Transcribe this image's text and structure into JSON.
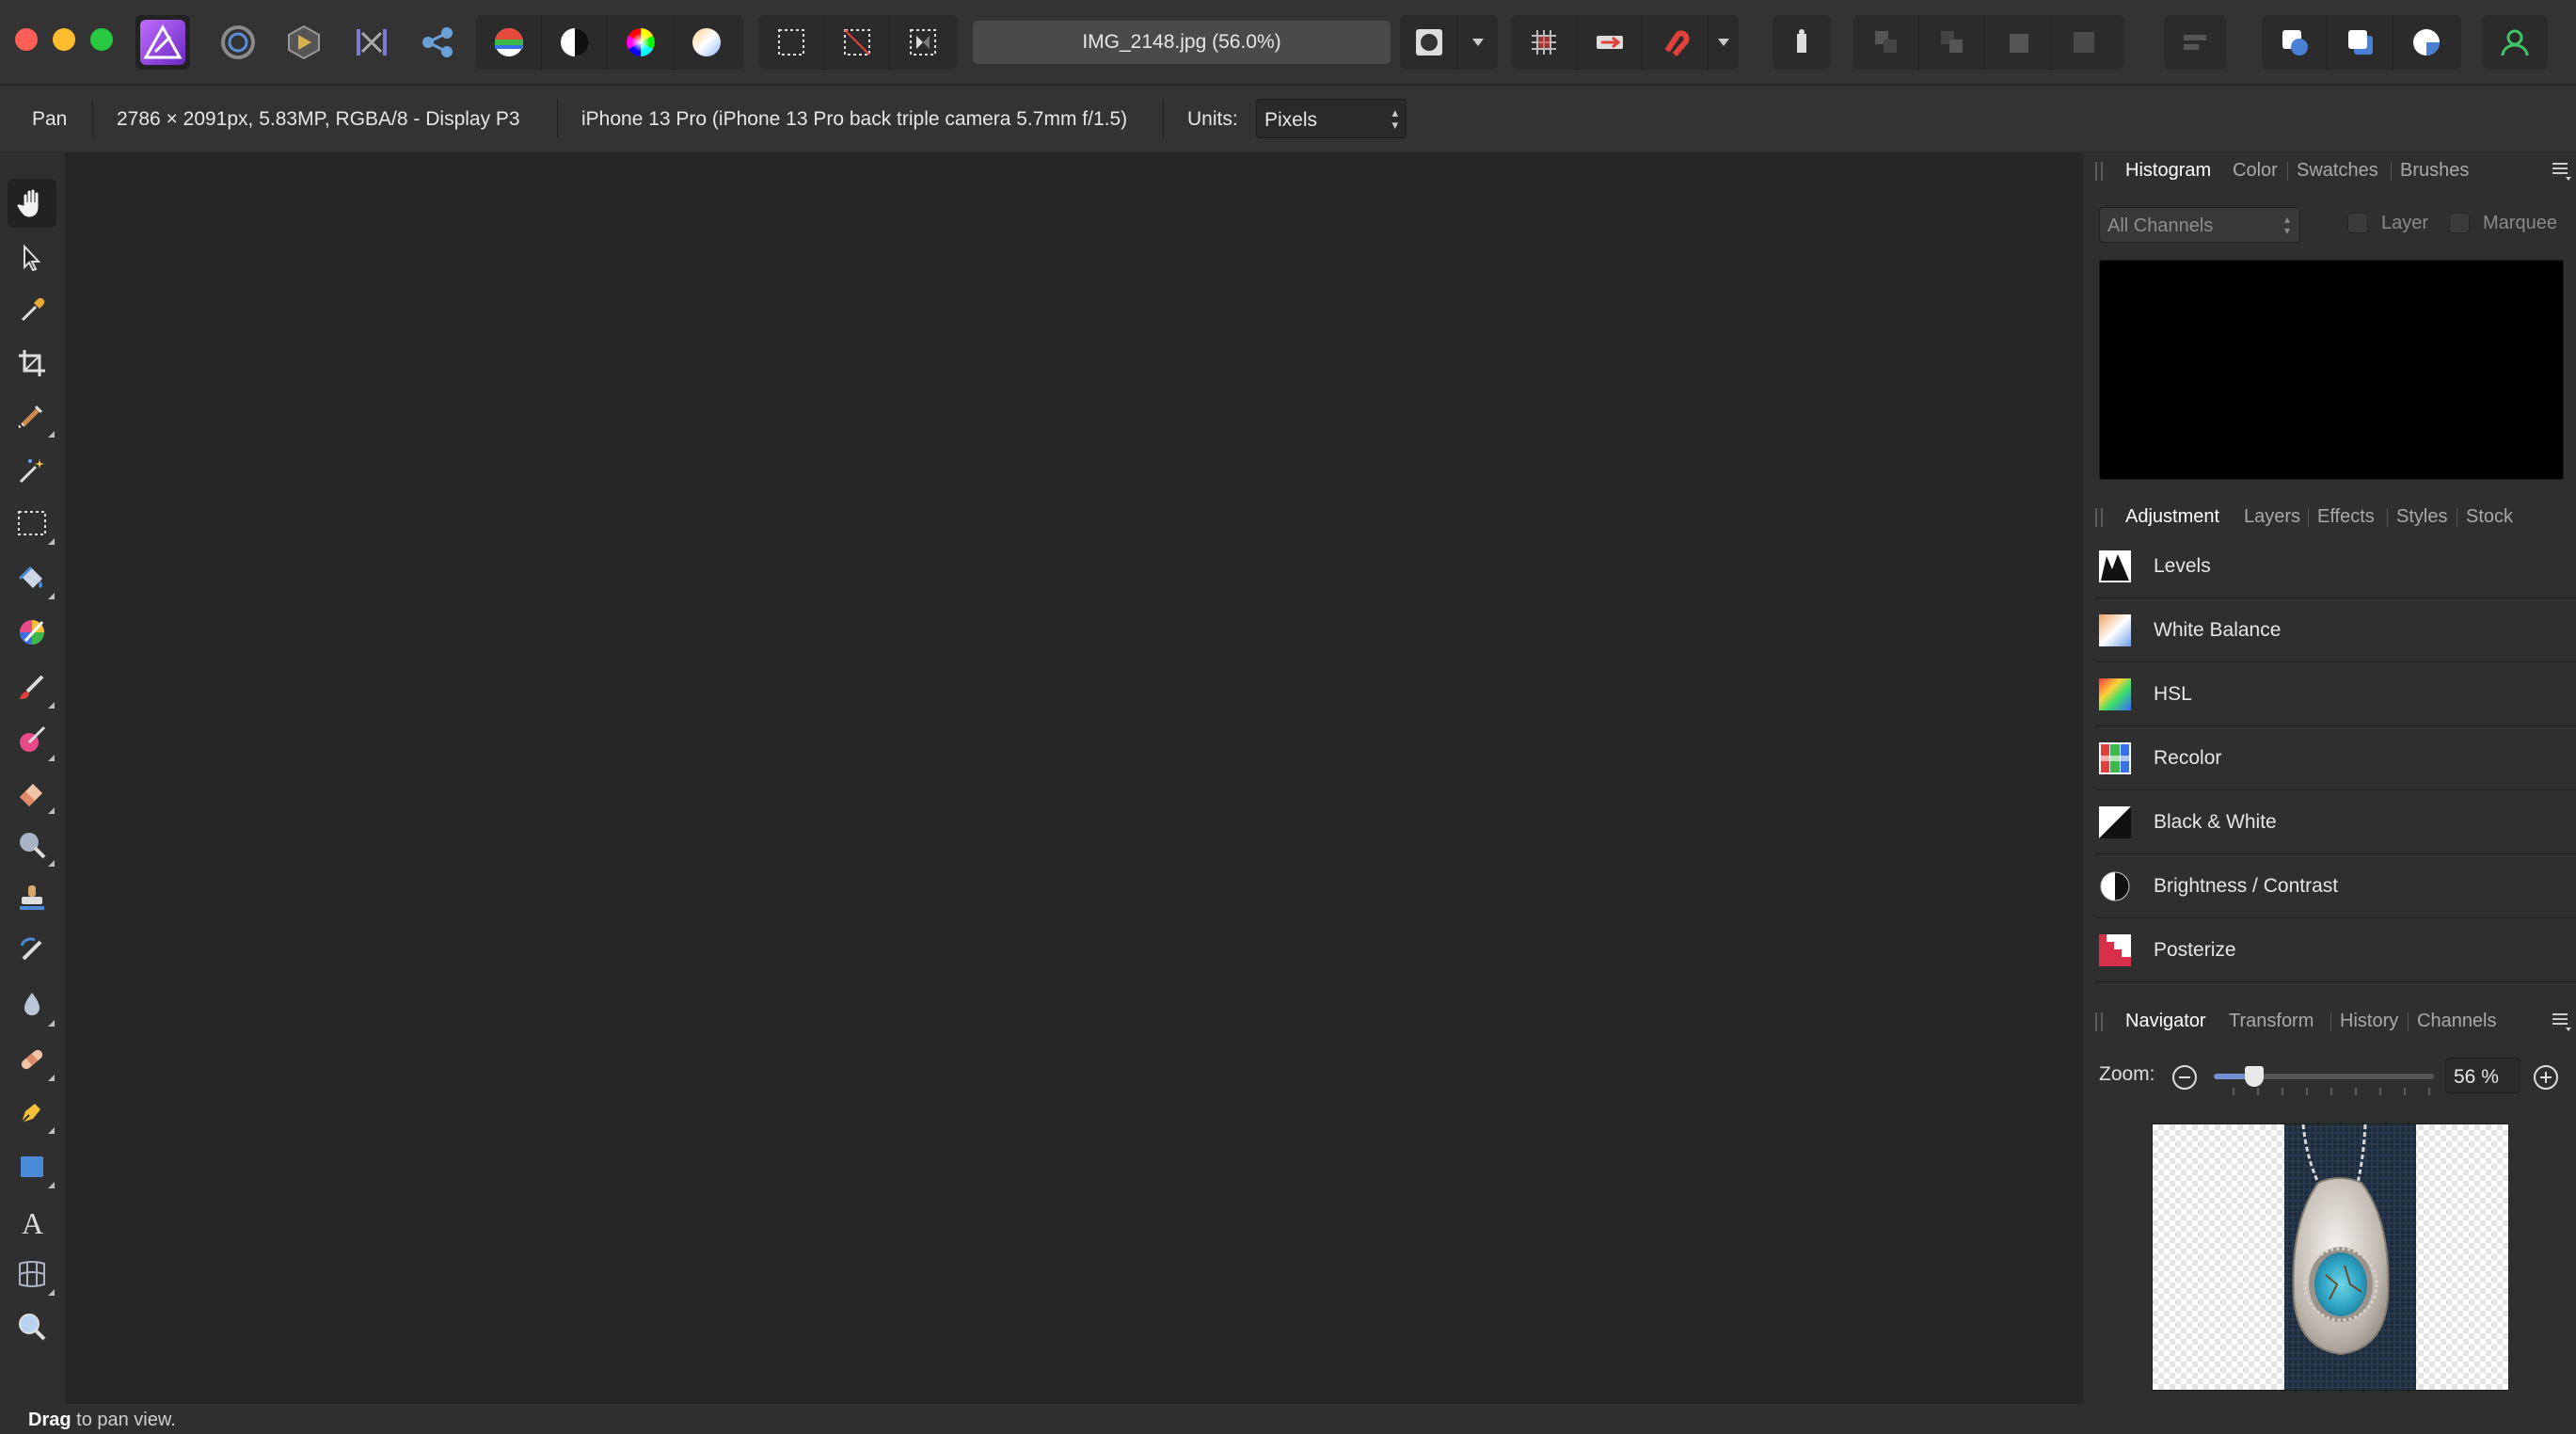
{
  "toolbar": {
    "document_title": "IMG_2148.jpg (56.0%)",
    "icons": [
      "photo-persona-icon",
      "liquify-persona-icon",
      "develop-persona-icon",
      "tone-mapping-persona-icon",
      "export-persona-icon",
      "auto-levels-icon",
      "auto-contrast-icon",
      "auto-colors-icon",
      "auto-white-balance-icon",
      "marquee-icon",
      "deselect-icon",
      "invert-pixel-selection-icon",
      "quick-mask-icon",
      "snapping-icon",
      "assistant-icon",
      "move-forward-icon",
      "arrange-icons",
      "align-icon",
      "insert-inside-icon",
      "insert-behind-icon",
      "insert-top-icon",
      "account-icon"
    ],
    "accent_color": "#8e4bd6"
  },
  "context": {
    "tool_name": "Pan",
    "doc_info": "2786 × 2091px, 5.83MP, RGBA/8 - Display P3",
    "camera_info": "iPhone 13 Pro (iPhone 13 Pro back triple camera 5.7mm f/1.5)",
    "units_label": "Units:",
    "units_value": "Pixels"
  },
  "panels": {
    "top_tabs": [
      "Histogram",
      "Color",
      "Swatches",
      "Brushes"
    ],
    "histogram": {
      "channel": "All Channels",
      "layer_label": "Layer",
      "marquee_label": "Marquee"
    },
    "mid_tabs": [
      "Adjustment",
      "Layers",
      "Effects",
      "Styles",
      "Stock"
    ],
    "adjustments": [
      {
        "label": "Levels",
        "icon": "levels-icon"
      },
      {
        "label": "White Balance",
        "icon": "white-balance-icon"
      },
      {
        "label": "HSL",
        "icon": "hsl-icon"
      },
      {
        "label": "Recolor",
        "icon": "recolor-icon"
      },
      {
        "label": "Black & White",
        "icon": "black-white-icon"
      },
      {
        "label": "Brightness / Contrast",
        "icon": "brightness-contrast-icon"
      },
      {
        "label": "Posterize",
        "icon": "posterize-icon"
      }
    ],
    "bottom_tabs": [
      "Navigator",
      "Transform",
      "History",
      "Channels"
    ],
    "navigator": {
      "zoom_label": "Zoom:",
      "zoom_value": "56 %",
      "zoom_fraction": 0.14
    }
  },
  "status": {
    "bold": "Drag",
    "text": " to pan view."
  }
}
